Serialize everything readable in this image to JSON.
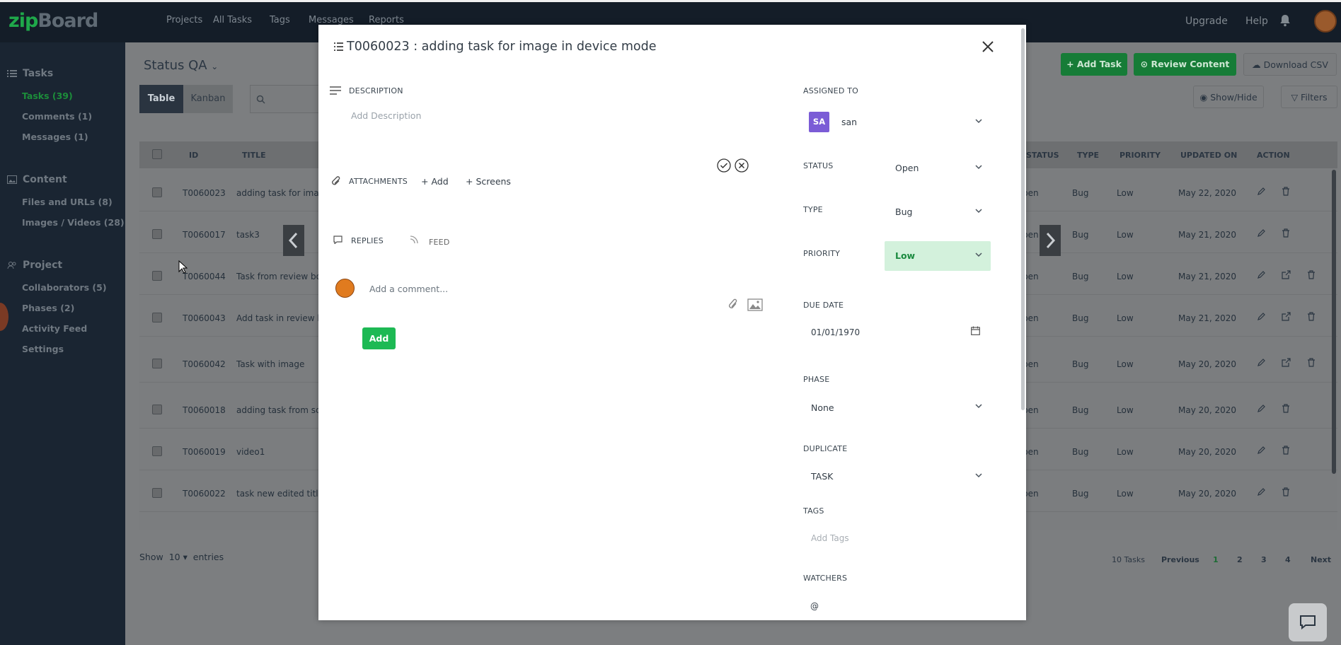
{
  "app": {
    "logo_prefix": "zip",
    "logo_suffix": "Board"
  },
  "topnav": {
    "items": [
      "Projects",
      "All Tasks",
      "Tags",
      "Messages",
      "Reports"
    ],
    "upgrade": "Upgrade",
    "help": "Help"
  },
  "sidebar": {
    "tasks_header": "Tasks",
    "tasks_items": [
      "Tasks (39)",
      "Comments (1)",
      "Messages (1)"
    ],
    "content_header": "Content",
    "content_items": [
      "Files and URLs (8)",
      "Images / Videos (28)"
    ],
    "project_header": "Project",
    "project_items": [
      "Collaborators (5)",
      "Phases (2)",
      "Activity Feed",
      "Settings"
    ]
  },
  "main": {
    "status_title": "Status QA",
    "tab_table": "Table",
    "tab_kanban": "Kanban",
    "add_task": "Add Task",
    "review_content": "Review Content",
    "download_csv": "Download CSV",
    "show_hide": "Show/Hide",
    "filters": "Filters",
    "columns": [
      "ID",
      "TITLE",
      "STATUS",
      "TYPE",
      "PRIORITY",
      "UPDATED ON",
      "ACTION"
    ],
    "rows": [
      {
        "id": "T0060023",
        "title": "adding task for imag",
        "status": "pen",
        "type": "Bug",
        "priority": "Low",
        "updated": "May 22, 2020"
      },
      {
        "id": "T0060017",
        "title": "task3",
        "status": "pen",
        "type": "Bug",
        "priority": "Low",
        "updated": "May 21, 2020"
      },
      {
        "id": "T0060044",
        "title": "Task from review bo",
        "status": "pen",
        "type": "Bug",
        "priority": "Low",
        "updated": "May 21, 2020"
      },
      {
        "id": "T0060043",
        "title": "Add task in review b",
        "status": "pen",
        "type": "Bug",
        "priority": "Low",
        "updated": "May 21, 2020"
      },
      {
        "id": "T0060042",
        "title": "Task with image",
        "status": "pen",
        "type": "Bug",
        "priority": "Low",
        "updated": "May 20, 2020"
      },
      {
        "id": "T0060018",
        "title": "adding task from scr",
        "status": "pen",
        "type": "Bug",
        "priority": "Low",
        "updated": "May 20, 2020"
      },
      {
        "id": "T0060019",
        "title": "video1",
        "status": "pen",
        "type": "Bug",
        "priority": "Low",
        "updated": "May 20, 2020"
      },
      {
        "id": "T0060022",
        "title": "task new edited title",
        "status": "pen",
        "type": "Bug",
        "priority": "Low",
        "updated": "May 20, 2020"
      }
    ],
    "show_label": "Show",
    "entries_value": "10",
    "entries_label": "entries",
    "tasks_count": "10 Tasks",
    "previous": "Previous",
    "pages": [
      "1",
      "2",
      "3",
      "4"
    ],
    "next": "Next"
  },
  "modal": {
    "title": "T0060023 : adding task for image in device mode",
    "description_label": "DESCRIPTION",
    "description_placeholder": "Add Description",
    "attachments_label": "ATTACHMENTS",
    "add_attachment": "Add",
    "screens": "Screens",
    "replies_tab": "REPLIES",
    "feed_tab": "FEED",
    "comment_placeholder": "Add a comment...",
    "add_button": "Add",
    "assigned_to_label": "ASSIGNED TO",
    "assignee_initials": "SA",
    "assignee_name": "san",
    "status_label": "STATUS",
    "status_value": "Open",
    "type_label": "TYPE",
    "type_value": "Bug",
    "priority_label": "PRIORITY",
    "priority_value": "Low",
    "due_date_label": "DUE DATE",
    "due_date_value": "01/01/1970",
    "phase_label": "PHASE",
    "phase_value": "None",
    "duplicate_label": "DUPLICATE",
    "duplicate_value": "TASK",
    "tags_label": "TAGS",
    "tags_placeholder": "Add Tags",
    "watchers_label": "WATCHERS",
    "watchers_value": "@"
  },
  "colors": {
    "brand_green": "#1db954",
    "priority_bg": "#d3f1dc",
    "avatar_purple": "#7b5cd6",
    "topbar": "#141d28"
  }
}
